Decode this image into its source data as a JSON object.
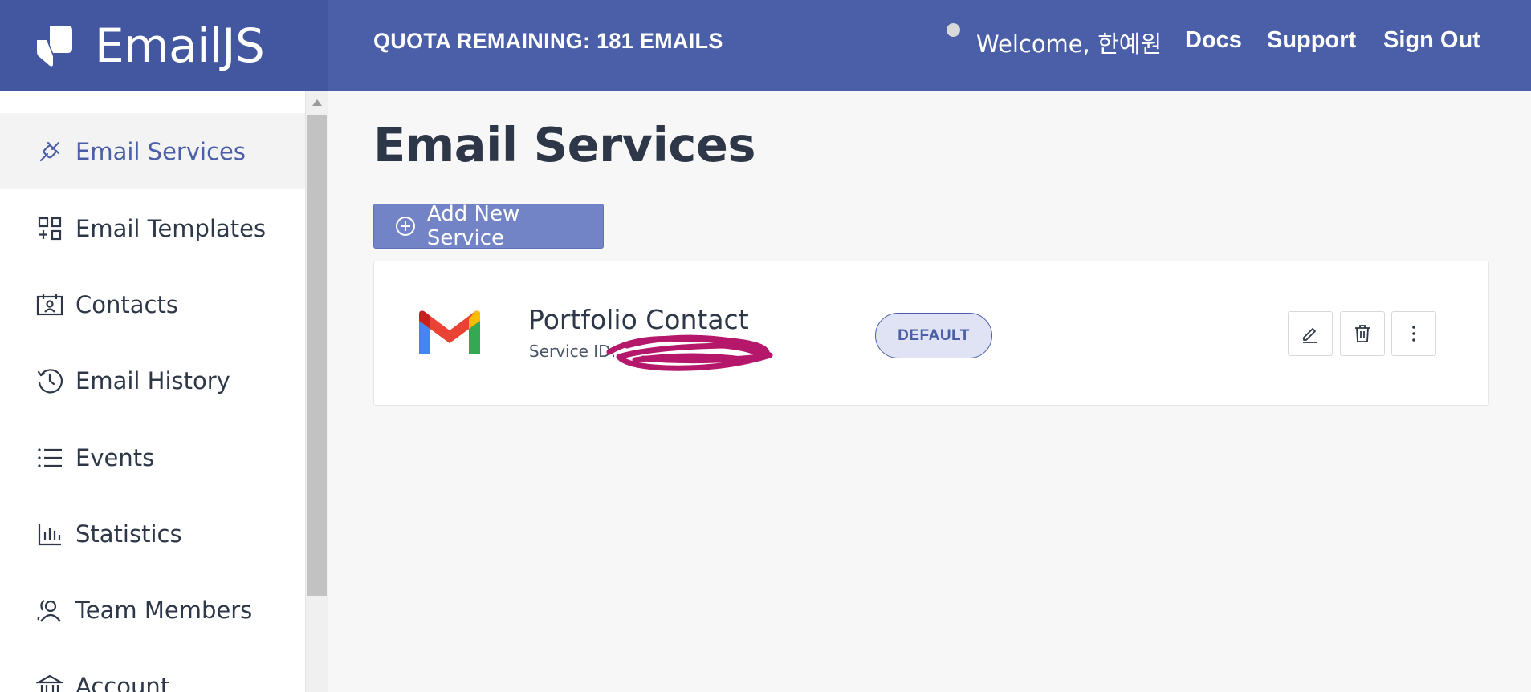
{
  "header": {
    "brand": "EmailJS",
    "quota": "QUOTA REMAINING: 181 EMAILS",
    "welcome": "Welcome, 한예원",
    "nav": {
      "docs": "Docs",
      "support": "Support",
      "sign_out": "Sign Out"
    },
    "colors": {
      "bar": "#4a5fa8",
      "brand_bg": "#4257a0",
      "status_dot": "#d9d9d9"
    }
  },
  "sidebar": {
    "active_color": "#4a5fa8",
    "items": [
      {
        "label": "Email Services",
        "icon": "plug-icon",
        "active": true
      },
      {
        "label": "Email Templates",
        "icon": "template-grid-icon",
        "active": false
      },
      {
        "label": "Contacts",
        "icon": "contact-card-icon",
        "active": false
      },
      {
        "label": "Email History",
        "icon": "clock-history-icon",
        "active": false
      },
      {
        "label": "Events",
        "icon": "list-icon",
        "active": false
      },
      {
        "label": "Statistics",
        "icon": "bar-chart-icon",
        "active": false
      },
      {
        "label": "Team Members",
        "icon": "users-icon",
        "active": false
      },
      {
        "label": "Account",
        "icon": "bank-icon",
        "active": false
      }
    ]
  },
  "main": {
    "title": "Email Services",
    "add_button": {
      "label": "Add New Service",
      "icon": "plus-circle-icon",
      "color": "#7384c6"
    },
    "services": [
      {
        "name": "Portfolio Contact",
        "id_label": "Service ID:",
        "provider_icon": "gmail-icon",
        "badge": "DEFAULT",
        "actions": [
          "pencil-icon",
          "trash-icon",
          "more-vertical-icon"
        ],
        "redaction_color": "#b5176a"
      }
    ]
  }
}
